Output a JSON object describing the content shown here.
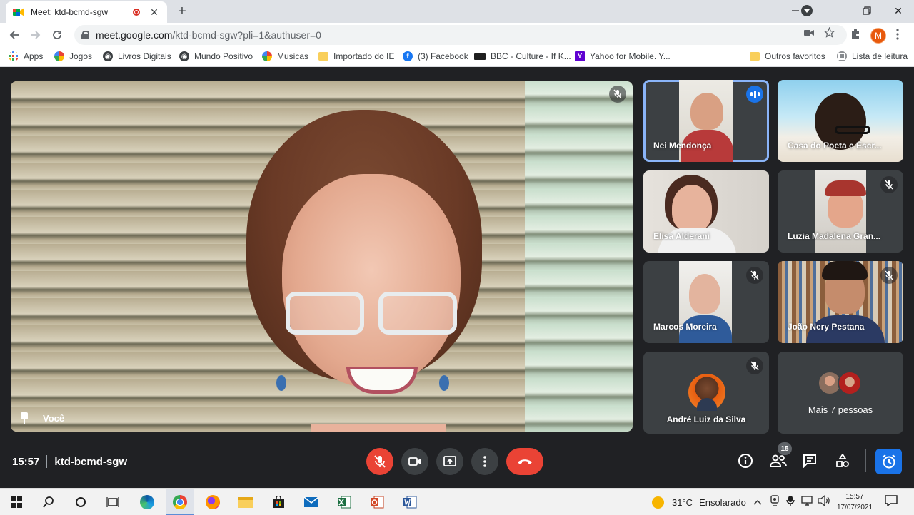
{
  "browser": {
    "tab_title": "Meet: ktd-bcmd-sgw",
    "new_tab": "+",
    "url_host": "meet.google.com",
    "url_path": "/ktd-bcmd-sgw?pli=1&authuser=0",
    "profile_initial": "M"
  },
  "bookmarks": [
    {
      "label": "Apps",
      "icon": "apps-grid-icon"
    },
    {
      "label": "Jogos",
      "icon": "globe-colorful-icon"
    },
    {
      "label": "Livros Digitais",
      "icon": "globe-icon"
    },
    {
      "label": "Mundo Positivo",
      "icon": "globe-icon"
    },
    {
      "label": "Musicas",
      "icon": "globe-colorful-icon"
    },
    {
      "label": "Importado do IE",
      "icon": "folder-icon"
    },
    {
      "label": "(3) Facebook",
      "icon": "facebook-icon"
    },
    {
      "label": "BBC - Culture - If K...",
      "icon": "bbc-icon"
    },
    {
      "label": "Yahoo for Mobile. Y...",
      "icon": "yahoo-icon"
    },
    {
      "label": "Outros favoritos",
      "icon": "folder-icon"
    },
    {
      "label": "Lista de leitura",
      "icon": "reading-list-icon"
    }
  ],
  "meeting": {
    "time": "15:57",
    "code": "ktd-bcmd-sgw",
    "self_label": "Você",
    "participant_count": "15"
  },
  "participants": [
    {
      "name": "Nei Mendonça",
      "speaking": true
    },
    {
      "name": "Casa do Poeta e Escr...",
      "speaking": false
    },
    {
      "name": "Elisa Alderani",
      "speaking": false
    },
    {
      "name": "Luzia Madalena Gran...",
      "speaking": false
    },
    {
      "name": "Marcos Moreira",
      "speaking": false
    },
    {
      "name": "João Nery Pestana",
      "speaking": false
    },
    {
      "name": "André Luiz da Silva",
      "speaking": false
    }
  ],
  "more_people_label": "Mais 7 pessoas",
  "taskbar": {
    "weather_temp": "31°C",
    "weather_desc": "Ensolarado",
    "clock_time": "15:57",
    "clock_date": "17/07/2021"
  },
  "colors": {
    "meet_bg": "#202124",
    "hangup_red": "#ea4335",
    "speaking_blue": "#1a73e8",
    "speaking_outline": "#8ab4f8"
  }
}
